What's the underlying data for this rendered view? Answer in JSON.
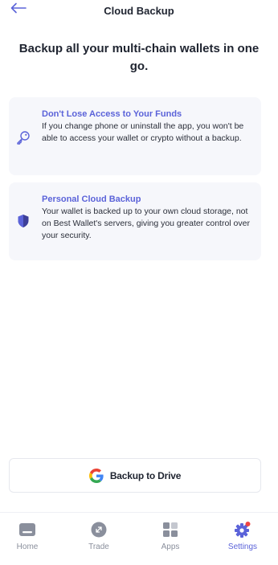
{
  "header": {
    "title": "Cloud Backup"
  },
  "heading": "Backup all your multi-chain wallets in one go.",
  "cards": [
    {
      "title": "Don't Lose Access to Your Funds",
      "body": "If you change phone or uninstall the app, you won't be able to access your wallet or crypto without a backup.",
      "icon": "key-icon"
    },
    {
      "title": "Personal Cloud Backup",
      "body": "Your wallet is backed up to your own cloud storage, not on Best Wallet's servers, giving you greater control over your security.",
      "icon": "shield-icon"
    }
  ],
  "drive_button": {
    "label": "Backup to Drive",
    "icon": "google-icon"
  },
  "tabs": [
    {
      "label": "Home",
      "icon": "wallet-icon",
      "active": false
    },
    {
      "label": "Trade",
      "icon": "trade-icon",
      "active": false
    },
    {
      "label": "Apps",
      "icon": "apps-icon",
      "active": false
    },
    {
      "label": "Settings",
      "icon": "gear-icon",
      "active": true
    }
  ],
  "colors": {
    "accent": "#5b63d9",
    "card_bg": "#f6f7fb",
    "text": "#1f2430",
    "inactive": "#8a8f9c",
    "notification_dot": "#ef4444"
  }
}
